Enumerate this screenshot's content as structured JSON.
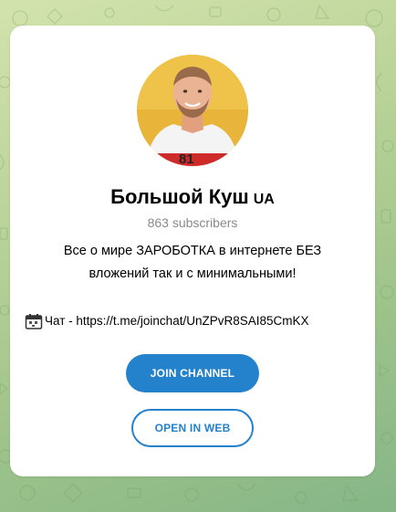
{
  "channel": {
    "title": "Большой Куш",
    "title_badge": "UA",
    "subscribers": "863 subscribers",
    "description_line1": "Все о мире ЗАРОБОТКА в интернете БЕЗ",
    "description_line2": "вложений так и с минимальными!",
    "chat_text": "Чат - https://t.me/joinchat/UnZPvR8SAI85CmKX",
    "avatar_shirt_number": "81"
  },
  "buttons": {
    "join_label": "JOIN CHANNEL",
    "web_label": "OPEN IN WEB"
  },
  "icons": {
    "chat": "calendar-emoji-icon"
  },
  "colors": {
    "accent": "#2481cc",
    "background": "#b9d398",
    "card": "#ffffff",
    "muted_text": "#8a8a8a",
    "avatar_bg": "#e8b53a"
  }
}
